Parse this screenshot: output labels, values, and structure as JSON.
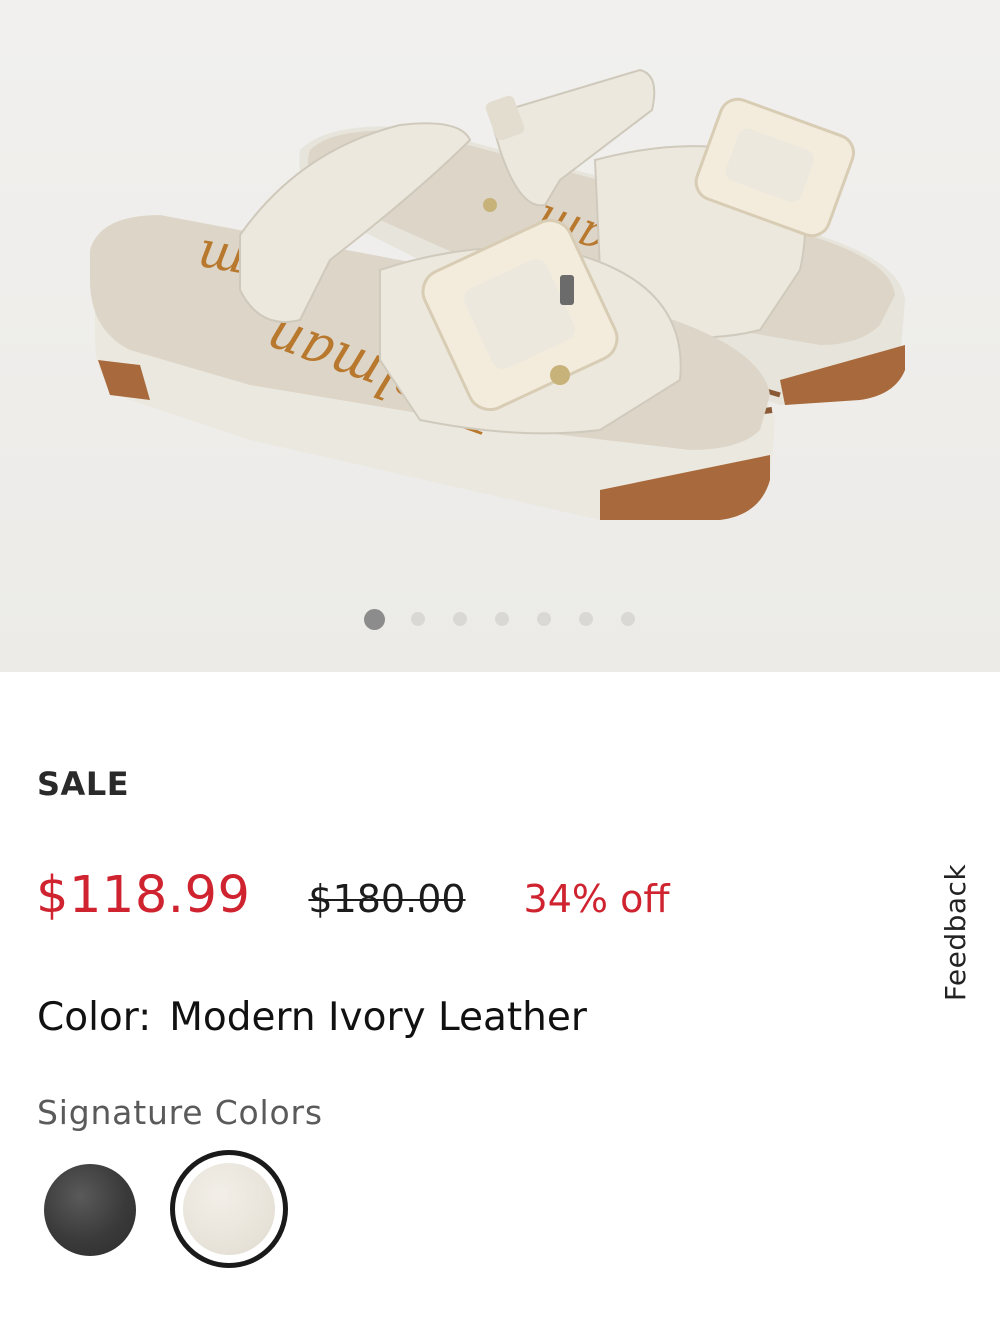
{
  "product_image": {
    "icon": "sandal-product-image",
    "carousel": {
      "total": 7,
      "active": 1
    }
  },
  "sale_label": "SALE",
  "price": {
    "sale": "$118.99",
    "original": "$180.00",
    "discount": "34% off",
    "sale_color": "#cf2330"
  },
  "color": {
    "label": "Color:",
    "value": "Modern Ivory Leather"
  },
  "signature": {
    "label": "Signature Colors",
    "swatches": [
      {
        "name": "black-leather",
        "color": "#3a3a3a",
        "selected": false
      },
      {
        "name": "modern-ivory-leather",
        "color": "#e6e2d8",
        "selected": true
      }
    ]
  },
  "feedback": {
    "label": "Feedback"
  }
}
